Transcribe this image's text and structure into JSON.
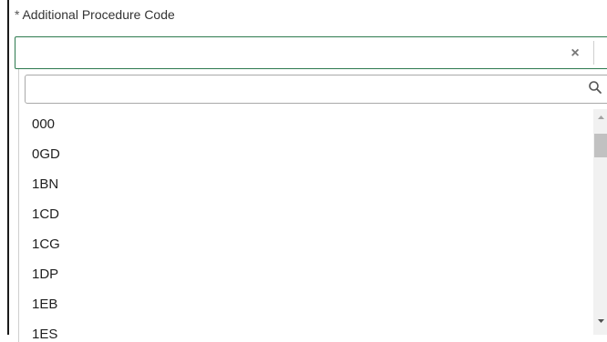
{
  "field": {
    "required_marker": "*",
    "label": "Additional Procedure Code",
    "selected_value": "",
    "clear_icon": "close-icon",
    "toggle_icon": "caret-up-icon"
  },
  "dropdown": {
    "search_value": "",
    "search_icon": "search-icon",
    "options": [
      "000",
      "0GD",
      "1BN",
      "1CD",
      "1CG",
      "1DP",
      "1EB",
      "1ES"
    ]
  },
  "colors": {
    "focus_border": "#2d7a4f",
    "scroll_thumb": "#c1c1c1"
  }
}
